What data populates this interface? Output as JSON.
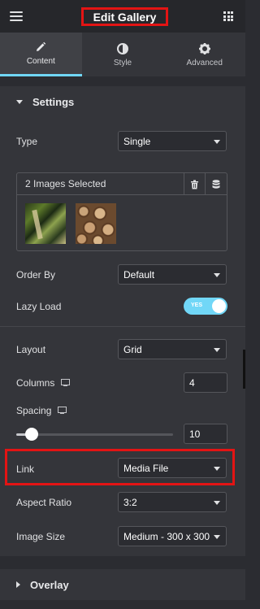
{
  "header": {
    "title": "Edit Gallery"
  },
  "tabs": [
    {
      "label": "Content",
      "icon": "pencil-icon",
      "active": true
    },
    {
      "label": "Style",
      "icon": "contrast-icon",
      "active": false
    },
    {
      "label": "Advanced",
      "icon": "gear-icon",
      "active": false
    }
  ],
  "settings": {
    "title": "Settings",
    "type": {
      "label": "Type",
      "value": "Single"
    },
    "gallery": {
      "selected_text": "2 Images Selected",
      "delete_icon": "trash-icon",
      "db_icon": "database-icon"
    },
    "order_by": {
      "label": "Order By",
      "value": "Default"
    },
    "lazy_load": {
      "label": "Lazy Load",
      "toggle_text": "YES",
      "on": true
    },
    "layout": {
      "label": "Layout",
      "value": "Grid"
    },
    "columns": {
      "label": "Columns",
      "value": "4"
    },
    "spacing": {
      "label": "Spacing",
      "value": "10"
    },
    "link": {
      "label": "Link",
      "value": "Media File"
    },
    "aspect_ratio": {
      "label": "Aspect Ratio",
      "value": "3:2"
    },
    "image_size": {
      "label": "Image Size",
      "value": "Medium - 300 x 300"
    }
  },
  "overlay": {
    "title": "Overlay"
  },
  "colors": {
    "accent": "#71d7f7",
    "highlight": "#e31414",
    "panel": "#34353a"
  }
}
